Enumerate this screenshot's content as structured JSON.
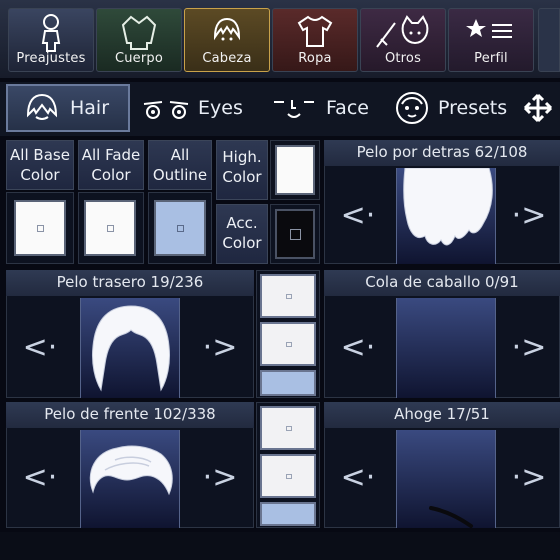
{
  "categories": [
    {
      "label": "Preajustes",
      "icon": "figure-icon"
    },
    {
      "label": "Cuerpo",
      "icon": "coat-icon"
    },
    {
      "label": "Cabeza",
      "icon": "head-icon",
      "active": true
    },
    {
      "label": "Ropa",
      "icon": "shirt-icon"
    },
    {
      "label": "Otros",
      "icon": "sword-cat-icon"
    },
    {
      "label": "Perfil",
      "icon": "star-list-icon"
    }
  ],
  "tabs": [
    {
      "label": "Hair",
      "icon": "hair-icon",
      "active": true
    },
    {
      "label": "Eyes",
      "icon": "eyes-icon"
    },
    {
      "label": "Face",
      "icon": "face-icon"
    },
    {
      "label": "Presets",
      "icon": "presets-icon"
    }
  ],
  "colors": {
    "all_base": "All Base Color",
    "all_fade": "All Fade Color",
    "all_outline": "All Outline",
    "high": "High. Color",
    "acc": "Acc. Color"
  },
  "sliders": {
    "pelo_detras": "Pelo por detras 62/108",
    "pelo_trasero": "Pelo trasero 19/236",
    "cola_caballo": "Cola de caballo 0/91",
    "pelo_frente": "Pelo de frente 102/338",
    "ahoge": "Ahoge 17/51"
  },
  "arrows": {
    "prev": "<·",
    "next": "·>"
  },
  "palette": {
    "accent_active": "#c9a24a",
    "preview_top": "#3a4a80",
    "preview_bottom": "#0f1430"
  }
}
